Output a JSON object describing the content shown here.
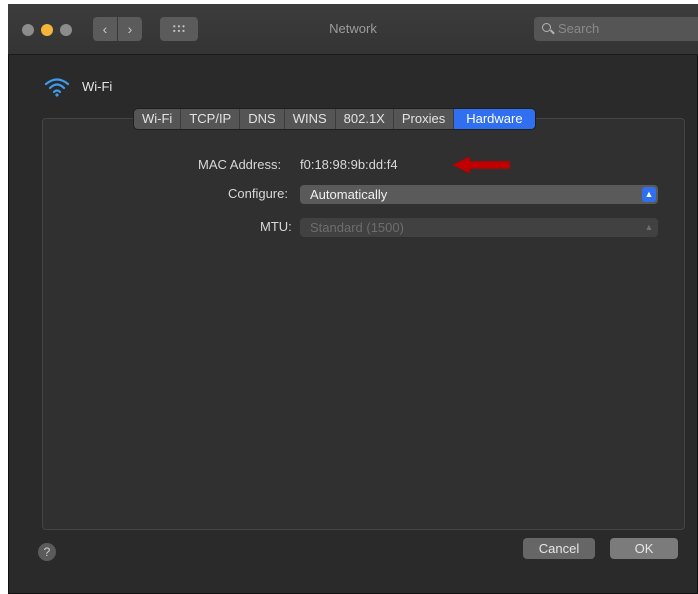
{
  "window": {
    "title": "Network",
    "search_placeholder": "Search",
    "nav_back_icon": "‹",
    "nav_forward_icon": "›"
  },
  "interface": {
    "name": "Wi-Fi"
  },
  "tabs": [
    {
      "label": "Wi-Fi"
    },
    {
      "label": "TCP/IP"
    },
    {
      "label": "DNS"
    },
    {
      "label": "WINS"
    },
    {
      "label": "802.1X"
    },
    {
      "label": "Proxies"
    },
    {
      "label": "Hardware",
      "active": true
    }
  ],
  "hardware": {
    "mac_label": "MAC Address:",
    "mac_value": "f0:18:98:9b:dd:f4",
    "configure_label": "Configure:",
    "configure_value": "Automatically",
    "mtu_label": "MTU:",
    "mtu_value": "Standard  (1500)"
  },
  "footer": {
    "help_glyph": "?",
    "cancel_label": "Cancel",
    "ok_label": "OK"
  },
  "colors": {
    "accent": "#2f6ff0",
    "arrow_annotation": "#c00000"
  }
}
